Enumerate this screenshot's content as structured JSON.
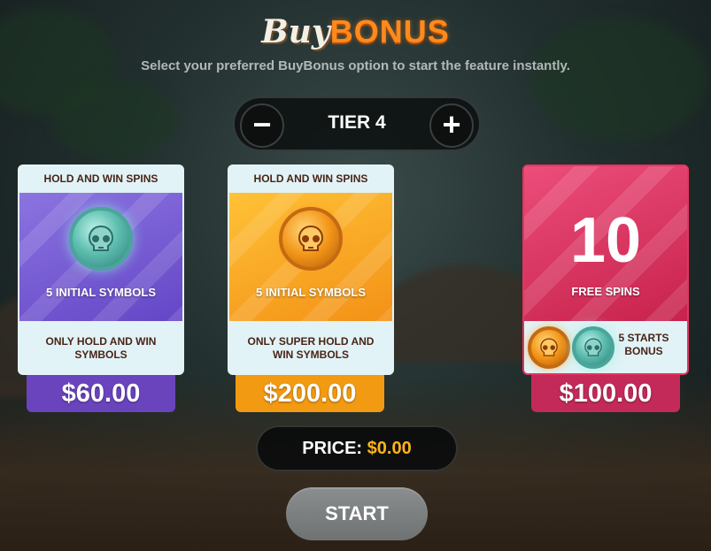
{
  "title": {
    "buy": "Buy",
    "bonus": "BONUS"
  },
  "subtitle": "Select your preferred BuyBonus option to start the feature instantly.",
  "tier": {
    "minus_label": "−",
    "label": "TIER 4",
    "plus_label": "+"
  },
  "cards": [
    {
      "header": "HOLD AND WIN SPINS",
      "mid_label": "5 INITIAL SYMBOLS",
      "footer": "ONLY HOLD AND WIN SYMBOLS",
      "price": "$60.00",
      "coin_icon": "teal-skull-coin-icon",
      "color": "#6a44bd"
    },
    {
      "header": "HOLD AND WIN SPINS",
      "mid_label": "5 INITIAL SYMBOLS",
      "footer": "ONLY SUPER HOLD AND WIN SYMBOLS",
      "price": "$200.00",
      "coin_icon": "gold-skull-coin-icon",
      "color": "#f29a12"
    },
    {
      "big_number": "10",
      "mid_label": "FREE SPINS",
      "footer": "5 STARTS BONUS",
      "price": "$100.00",
      "coin_icons": [
        "gold-skull-coin-icon",
        "teal-skull-coin-icon"
      ],
      "color": "#c32a59"
    }
  ],
  "price_box": {
    "label": "PRICE:",
    "value": "$0.00"
  },
  "start_button": "START",
  "colors": {
    "accent_orange": "#ff8a1c",
    "price_value": "#ffb31a"
  }
}
